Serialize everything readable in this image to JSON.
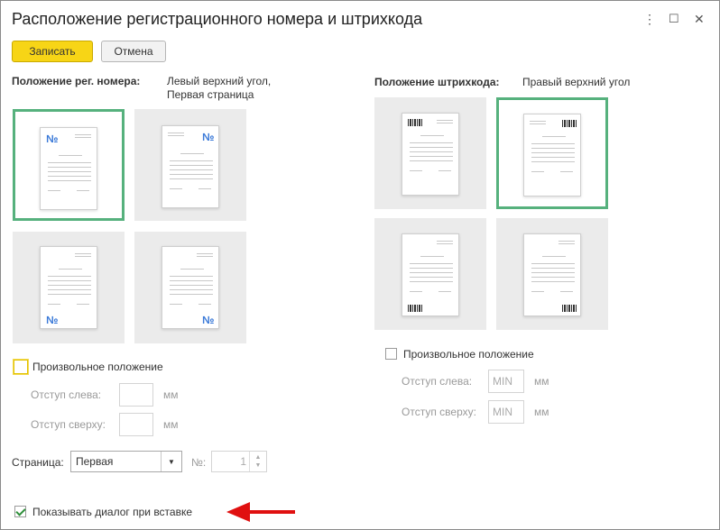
{
  "window": {
    "title": "Расположение регистрационного номера и штрихкода",
    "more_glyph": "⋮",
    "maximize_glyph": "☐",
    "close_glyph": "✕"
  },
  "toolbar": {
    "save_label": "Записать",
    "cancel_label": "Отмена"
  },
  "reg_number": {
    "label": "Положение рег. номера:",
    "value_line1": "Левый верхний угол,",
    "value_line2": "Первая страница",
    "glyph": "№",
    "positions": [
      "top-left",
      "top-right",
      "bottom-left",
      "bottom-right"
    ],
    "selected": "top-left",
    "custom_label": "Произвольное положение",
    "custom_checked": false,
    "offset_left_label": "Отступ слева:",
    "offset_left_value": "",
    "offset_top_label": "Отступ сверху:",
    "offset_top_value": "",
    "unit": "мм"
  },
  "barcode": {
    "label": "Положение штрихкода:",
    "value": "Правый верхний угол",
    "positions": [
      "top-left",
      "top-right",
      "bottom-left",
      "bottom-right"
    ],
    "selected": "top-right",
    "custom_label": "Произвольное положение",
    "custom_checked": false,
    "offset_left_label": "Отступ слева:",
    "offset_left_value": "MIN",
    "offset_top_label": "Отступ сверху:",
    "offset_top_value": "MIN",
    "unit": "мм"
  },
  "page_field": {
    "label": "Страница:",
    "value": "Первая",
    "number_label": "№:",
    "number_value": "1"
  },
  "show_dialog": {
    "label": "Показывать диалог при вставке",
    "checked": true
  },
  "colors": {
    "primary": "#f7d516",
    "selected_border": "#56b17d",
    "number_glyph": "#3b7ad8",
    "arrow": "#e01010"
  }
}
